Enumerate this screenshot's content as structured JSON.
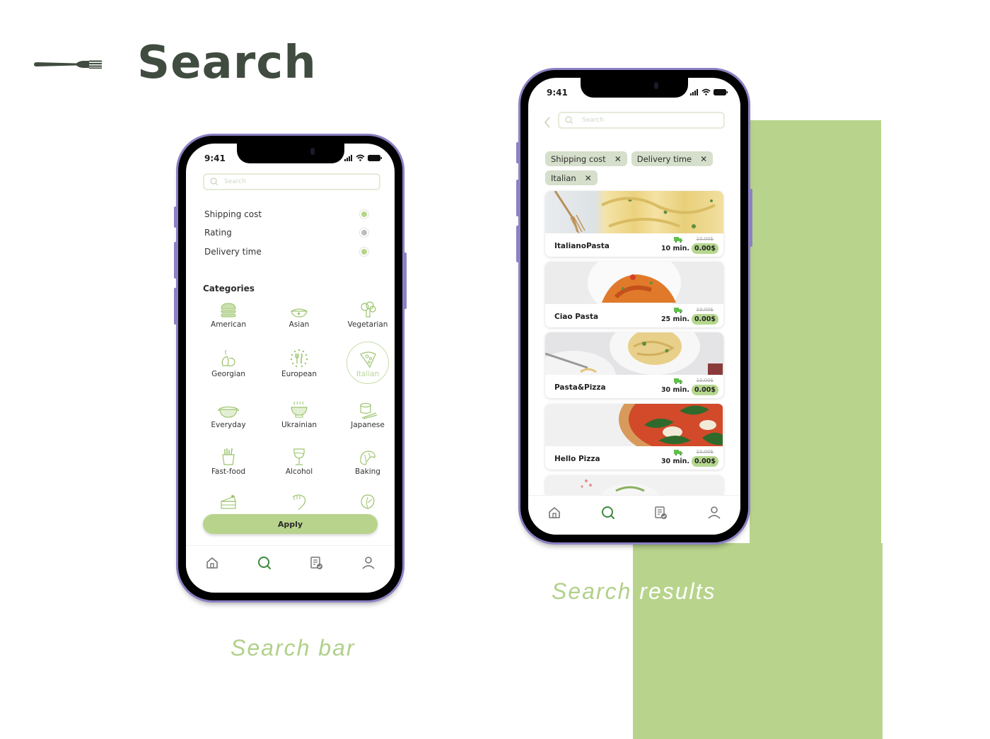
{
  "header": {
    "title": "Search",
    "logo_icon": "fork-icon"
  },
  "colors": {
    "accent_green": "#b8d48c",
    "title_dark": "#414c40",
    "phone_frame": "#8c80c4",
    "icon_green": "#3b8a3e"
  },
  "captions": {
    "left": "Search bar",
    "right_word1": "Search",
    "right_word2": "results"
  },
  "search_screen": {
    "status_time": "9:41",
    "search_placeholder": "Search",
    "filters": [
      {
        "label": "Shipping cost",
        "selected": true
      },
      {
        "label": "Rating",
        "selected": false
      },
      {
        "label": "Delivery time",
        "selected": true
      }
    ],
    "categories_title": "Categories",
    "categories": [
      {
        "label": "American",
        "icon": "burger-icon"
      },
      {
        "label": "Asian",
        "icon": "bowl-icon"
      },
      {
        "label": "Vegetarian",
        "icon": "broccoli-icon"
      },
      {
        "label": "Georgian",
        "icon": "dumpling-icon"
      },
      {
        "label": "European",
        "icon": "europe-cutlery-icon"
      },
      {
        "label": "Italian",
        "icon": "pizza-slice-icon",
        "selected": true
      },
      {
        "label": "Everyday",
        "icon": "pot-icon"
      },
      {
        "label": "Ukrainian",
        "icon": "soup-icon"
      },
      {
        "label": "Japanese",
        "icon": "sushi-icon"
      },
      {
        "label": "Fast-food",
        "icon": "fries-icon"
      },
      {
        "label": "Alcohol",
        "icon": "wine-glass-icon"
      },
      {
        "label": "Baking",
        "icon": "croissant-icon"
      },
      {
        "label": "",
        "icon": "cake-icon"
      },
      {
        "label": "",
        "icon": "shrimp-icon"
      },
      {
        "label": "",
        "icon": "lettuce-icon"
      }
    ],
    "apply_label": "Apply",
    "tabs": [
      {
        "name": "home",
        "icon": "home-icon",
        "active": false
      },
      {
        "name": "search",
        "icon": "search-icon",
        "active": true
      },
      {
        "name": "orders",
        "icon": "orders-icon",
        "active": false
      },
      {
        "name": "profile",
        "icon": "profile-icon",
        "active": false
      }
    ]
  },
  "results_screen": {
    "status_time": "9:41",
    "search_placeholder": "Search",
    "chips": [
      {
        "label": "Shipping cost"
      },
      {
        "label": "Delivery time"
      },
      {
        "label": "Italian"
      }
    ],
    "chip_close": "✕",
    "results": [
      {
        "name": "ItalianoPasta",
        "time": "10 min.",
        "old_price": "10.00$",
        "price": "0.00$",
        "image": "pasta-tagliatelle"
      },
      {
        "name": "Ciao Pasta",
        "time": "25 min.",
        "old_price": "10.00$",
        "price": "0.00$",
        "image": "pasta-shrimp"
      },
      {
        "name": "Pasta&Pizza",
        "time": "30 min.",
        "old_price": "10.00$",
        "price": "0.00$",
        "image": "spaghetti-plates"
      },
      {
        "name": "Hello Pizza",
        "time": "30 min.",
        "old_price": "10.00$",
        "price": "0.00$",
        "image": "pizza-basil"
      }
    ]
  }
}
